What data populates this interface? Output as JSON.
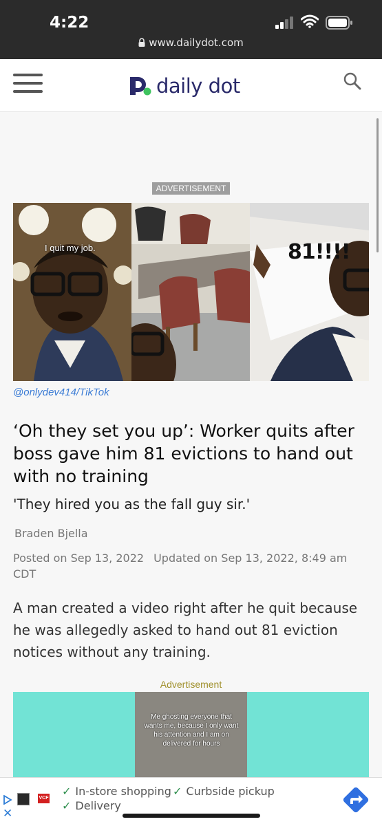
{
  "status_bar": {
    "time": "4:22",
    "url": "www.dailydot.com"
  },
  "nav": {
    "logo_text": "daily dot"
  },
  "ad_top": {
    "label": "ADVERTISEMENT"
  },
  "hero": {
    "caption_left": "I quit my job.",
    "caption_right": "81!!!!",
    "credit": "@onlydev414/TikTok"
  },
  "article": {
    "headline": "‘Oh they set you up’: Worker quits after boss gave him 81 evictions to hand out with no training",
    "subhead": "'They hired you as the fall guy sir.'",
    "author": "Braden Bjella",
    "posted": "Posted on Sep 13, 2022",
    "updated": "Updated on Sep 13, 2022, 8:49 am CDT",
    "body": "A man created a video right after he quit because he was allegedly asked to hand out 81 eviction notices without any training."
  },
  "ad_middle": {
    "label": "Advertisement",
    "overlay_text": "Me ghosting everyone that wants me, because I only want his attention and I am on delivered for hours"
  },
  "bottom_ad": {
    "item1": "In-store shopping",
    "item2": "Curbside pickup",
    "item3": "Delivery",
    "close": "✕",
    "brand_badge": "VCF"
  },
  "colors": {
    "brand": "#2a2a6a",
    "brand_dot": "#3fc35f",
    "link": "#3a7bd5",
    "ad_bg": "#72e3d5"
  }
}
